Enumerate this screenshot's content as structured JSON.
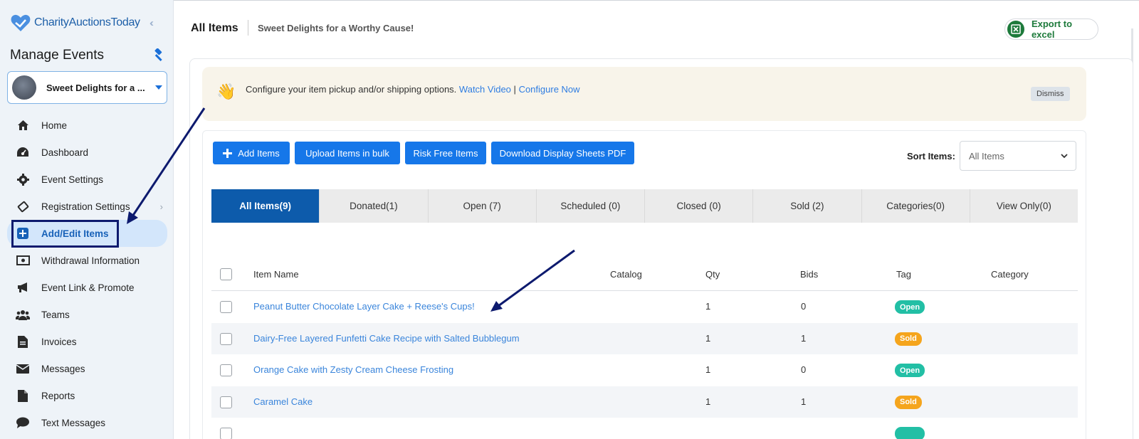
{
  "brand": {
    "logo_text": "CharityAuctionsToday"
  },
  "sidebar": {
    "title": "Manage Events",
    "event_name": "Sweet Delights for a ...",
    "items": [
      {
        "label": "Home",
        "icon": "home-icon"
      },
      {
        "label": "Dashboard",
        "icon": "dashboard-icon"
      },
      {
        "label": "Event Settings",
        "icon": "gear-icon"
      },
      {
        "label": "Registration Settings",
        "icon": "ticket-icon"
      },
      {
        "label": "Add/Edit Items",
        "icon": "plus-square-icon"
      },
      {
        "label": "Withdrawal Information",
        "icon": "money-icon"
      },
      {
        "label": "Event Link & Promote",
        "icon": "megaphone-icon"
      },
      {
        "label": "Teams",
        "icon": "users-icon"
      },
      {
        "label": "Invoices",
        "icon": "invoice-icon"
      },
      {
        "label": "Messages",
        "icon": "envelope-icon"
      },
      {
        "label": "Reports",
        "icon": "report-icon"
      },
      {
        "label": "Text Messages",
        "icon": "chat-icon"
      }
    ]
  },
  "header": {
    "title": "All Items",
    "subtitle": "Sweet Delights for a Worthy Cause!",
    "export_label": "Export to excel"
  },
  "notice": {
    "text": "Configure your item pickup and/or shipping options.",
    "watch_video": "Watch Video",
    "separator": "|",
    "configure_now": "Configure Now",
    "dismiss": "Dismiss"
  },
  "toolbar": {
    "add_items": "Add Items",
    "upload_bulk": "Upload Items in bulk",
    "risk_free": "Risk Free Items",
    "download_pdf": "Download Display Sheets PDF",
    "sort_label": "Sort Items:",
    "sort_value": "All Items"
  },
  "tabs": [
    "All Items(9)",
    "Donated(1)",
    "Open (7)",
    "Scheduled (0)",
    "Closed (0)",
    "Sold (2)",
    "Categories(0)",
    "View Only(0)"
  ],
  "table": {
    "columns": {
      "item_name": "Item Name",
      "catalog": "Catalog",
      "qty": "Qty",
      "bids": "Bids",
      "tag": "Tag",
      "category": "Category"
    },
    "rows": [
      {
        "name": "Peanut Butter Chocolate Layer Cake + Reese's Cups!",
        "qty": "1",
        "bids": "0",
        "tag": "Open"
      },
      {
        "name": "Dairy-Free Layered Funfetti Cake Recipe with Salted Bubblegum",
        "qty": "1",
        "bids": "1",
        "tag": "Sold"
      },
      {
        "name": "Orange Cake with Zesty Cream Cheese Frosting",
        "qty": "1",
        "bids": "0",
        "tag": "Open"
      },
      {
        "name": "Caramel Cake",
        "qty": "1",
        "bids": "1",
        "tag": "Sold"
      }
    ]
  },
  "colors": {
    "primary": "#1677e9",
    "active_tab": "#0d5bab",
    "open_tag": "#22bfa5",
    "sold_tag": "#f5a51d",
    "annotation": "#0d1a6e"
  }
}
